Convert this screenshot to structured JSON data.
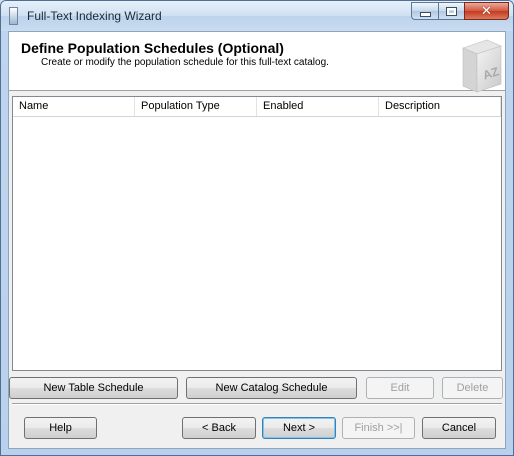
{
  "window": {
    "title": "Full-Text Indexing Wizard",
    "caption_buttons": {
      "minimize_icon": "minimize-icon",
      "maximize_icon": "maximize-icon",
      "close_icon": "close-icon",
      "close_glyph": "✕"
    }
  },
  "header": {
    "title": "Define Population Schedules (Optional)",
    "subtitle": "Create or modify the population schedule for this full-text catalog.",
    "icon": "az-book-icon",
    "icon_text": "AZ"
  },
  "schedule_list": {
    "columns": [
      "Name",
      "Population Type",
      "Enabled",
      "Description"
    ],
    "rows": []
  },
  "list_actions": {
    "new_table_schedule": "New Table Schedule",
    "new_catalog_schedule": "New Catalog Schedule",
    "edit": "Edit",
    "delete": "Delete"
  },
  "footer": {
    "help": "Help",
    "back": "< Back",
    "next": "Next >",
    "finish": "Finish >>|",
    "cancel": "Cancel"
  },
  "colors": {
    "title_bar": "#cfe0f2",
    "close_button": "#c43a1f",
    "dialog_background": "#f0f0f0",
    "default_button_border": "#3c7fb1"
  }
}
